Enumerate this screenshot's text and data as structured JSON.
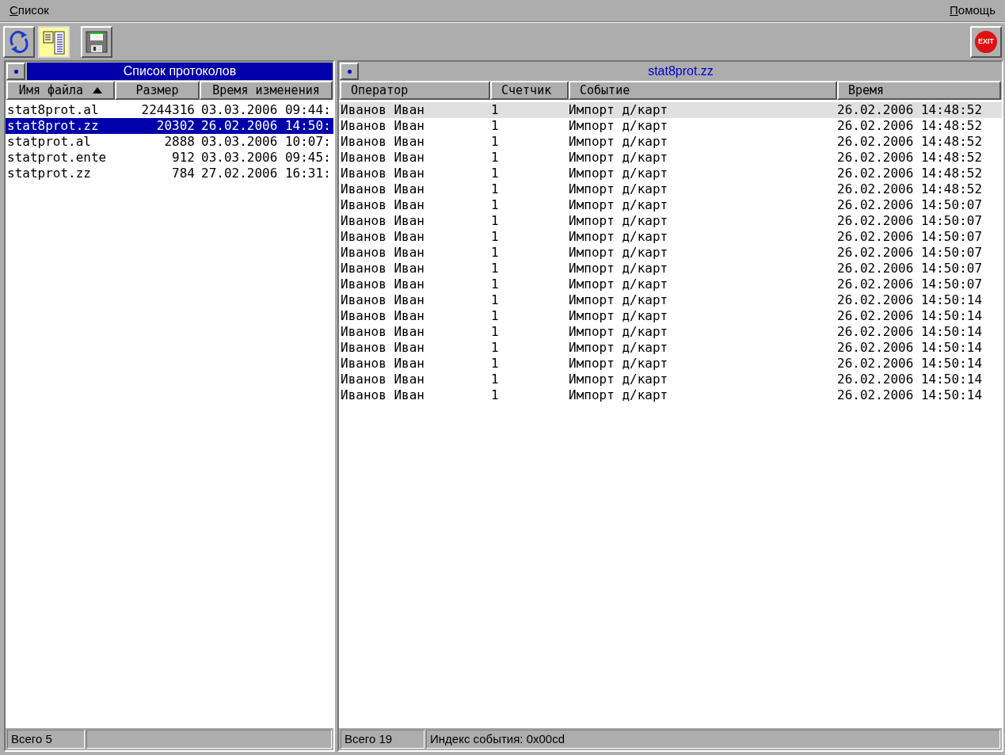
{
  "menu": [
    {
      "label": "Список"
    },
    {
      "label": "Помощь"
    }
  ],
  "toolbar": [
    {
      "kind": "refresh",
      "pressed": false
    },
    {
      "kind": "panels",
      "pressed": true
    },
    {
      "kind": "save",
      "pressed": false
    }
  ],
  "exit_button": {
    "label": "EXIT"
  },
  "file_panel": {
    "title": "Список протоколов",
    "active": true,
    "columns": [
      {
        "label": "Имя файла",
        "sorted": true
      },
      {
        "label": "Размер",
        "sorted": false
      },
      {
        "label": "Время изменения",
        "sorted": false
      }
    ],
    "rows": [
      {
        "name": "stat8prot.al",
        "size": "2244316",
        "modified": "03.03.2006 09:44:",
        "selected": false
      },
      {
        "name": "stat8prot.zz",
        "size": "20302",
        "modified": "26.02.2006 14:50:",
        "selected": true
      },
      {
        "name": "statprot.al",
        "size": "2888",
        "modified": "03.03.2006 10:07:",
        "selected": false
      },
      {
        "name": "statprot.ente",
        "size": "912",
        "modified": "03.03.2006 09:45:",
        "selected": false
      },
      {
        "name": "statprot.zz",
        "size": "784",
        "modified": "27.02.2006 16:31:",
        "selected": false
      }
    ],
    "status": [
      "Всего 5"
    ]
  },
  "event_panel": {
    "title": "stat8prot.zz",
    "active": false,
    "columns": [
      {
        "label": "Оператор"
      },
      {
        "label": "Счетчик"
      },
      {
        "label": "Событие"
      },
      {
        "label": "Время"
      }
    ],
    "rows": [
      {
        "operator": "Иванов Иван",
        "counter": "1",
        "event": "Импорт д/карт",
        "time": "26.02.2006 14:48:52",
        "selected": true
      },
      {
        "operator": "Иванов Иван",
        "counter": "1",
        "event": "Импорт д/карт",
        "time": "26.02.2006 14:48:52",
        "selected": false
      },
      {
        "operator": "Иванов Иван",
        "counter": "1",
        "event": "Импорт д/карт",
        "time": "26.02.2006 14:48:52",
        "selected": false
      },
      {
        "operator": "Иванов Иван",
        "counter": "1",
        "event": "Импорт д/карт",
        "time": "26.02.2006 14:48:52",
        "selected": false
      },
      {
        "operator": "Иванов Иван",
        "counter": "1",
        "event": "Импорт д/карт",
        "time": "26.02.2006 14:48:52",
        "selected": false
      },
      {
        "operator": "Иванов Иван",
        "counter": "1",
        "event": "Импорт д/карт",
        "time": "26.02.2006 14:48:52",
        "selected": false
      },
      {
        "operator": "Иванов Иван",
        "counter": "1",
        "event": "Импорт д/карт",
        "time": "26.02.2006 14:50:07",
        "selected": false
      },
      {
        "operator": "Иванов Иван",
        "counter": "1",
        "event": "Импорт д/карт",
        "time": "26.02.2006 14:50:07",
        "selected": false
      },
      {
        "operator": "Иванов Иван",
        "counter": "1",
        "event": "Импорт д/карт",
        "time": "26.02.2006 14:50:07",
        "selected": false
      },
      {
        "operator": "Иванов Иван",
        "counter": "1",
        "event": "Импорт д/карт",
        "time": "26.02.2006 14:50:07",
        "selected": false
      },
      {
        "operator": "Иванов Иван",
        "counter": "1",
        "event": "Импорт д/карт",
        "time": "26.02.2006 14:50:07",
        "selected": false
      },
      {
        "operator": "Иванов Иван",
        "counter": "1",
        "event": "Импорт д/карт",
        "time": "26.02.2006 14:50:07",
        "selected": false
      },
      {
        "operator": "Иванов Иван",
        "counter": "1",
        "event": "Импорт д/карт",
        "time": "26.02.2006 14:50:14",
        "selected": false
      },
      {
        "operator": "Иванов Иван",
        "counter": "1",
        "event": "Импорт д/карт",
        "time": "26.02.2006 14:50:14",
        "selected": false
      },
      {
        "operator": "Иванов Иван",
        "counter": "1",
        "event": "Импорт д/карт",
        "time": "26.02.2006 14:50:14",
        "selected": false
      },
      {
        "operator": "Иванов Иван",
        "counter": "1",
        "event": "Импорт д/карт",
        "time": "26.02.2006 14:50:14",
        "selected": false
      },
      {
        "operator": "Иванов Иван",
        "counter": "1",
        "event": "Импорт д/карт",
        "time": "26.02.2006 14:50:14",
        "selected": false
      },
      {
        "operator": "Иванов Иван",
        "counter": "1",
        "event": "Импорт д/карт",
        "time": "26.02.2006 14:50:14",
        "selected": false
      },
      {
        "operator": "Иванов Иван",
        "counter": "1",
        "event": "Импорт д/карт",
        "time": "26.02.2006 14:50:14",
        "selected": false
      }
    ],
    "status": [
      "Всего 19",
      "Индекс события: 0x00cd"
    ]
  }
}
